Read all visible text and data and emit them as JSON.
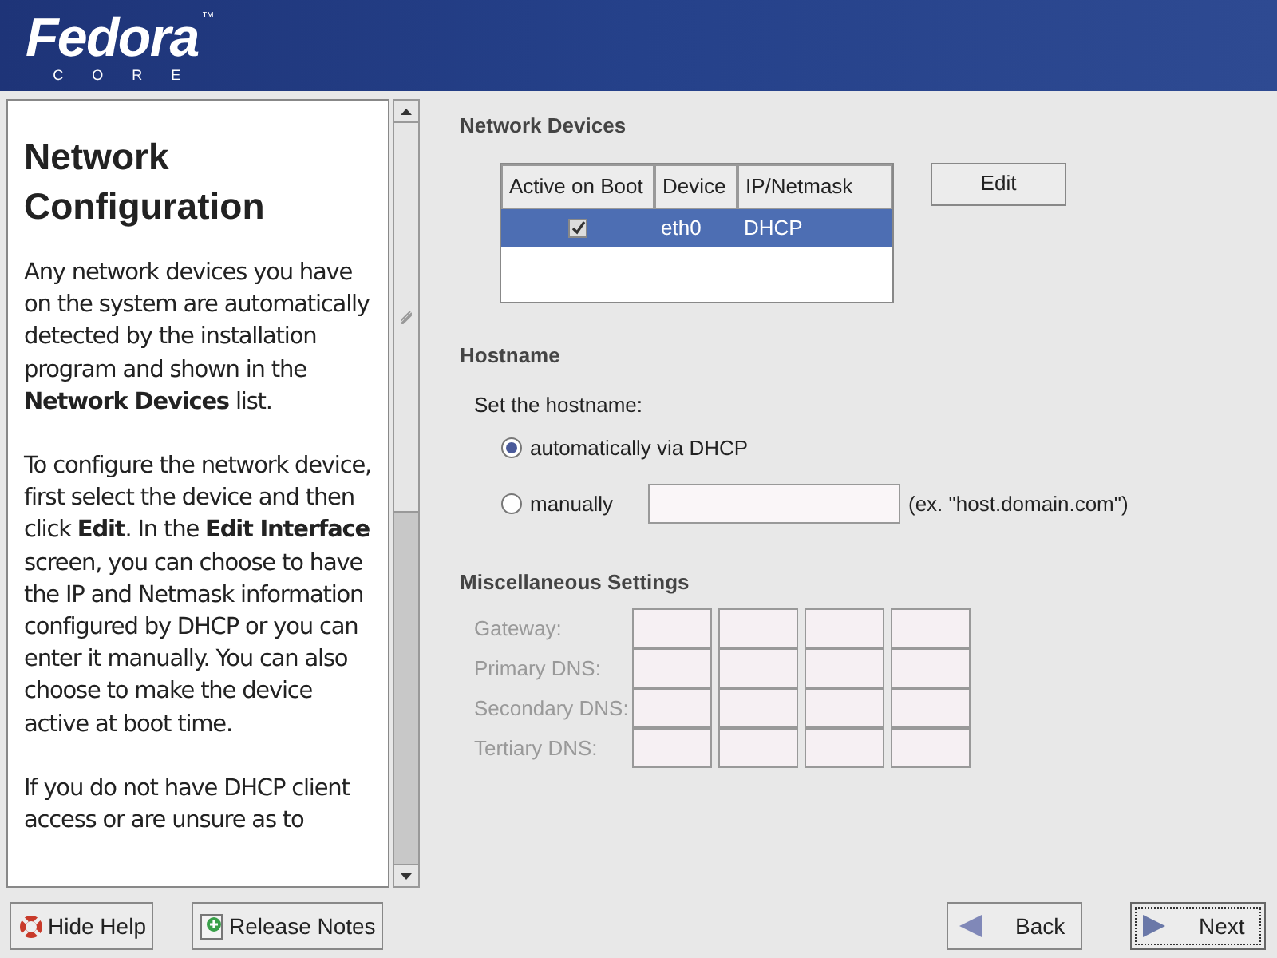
{
  "header": {
    "logo": "Fedora",
    "trademark": "™",
    "subtitle": "CORE"
  },
  "help": {
    "title": "Network Configuration",
    "paragraphs": [
      "Any network devices you have on the system are automatically detected by the installation program and shown in the **Network Devices** list.",
      "To configure the network device, first select the device and then click **Edit**. In the **Edit Interface** screen, you can choose to have the IP and Netmask information configured by DHCP or you can enter it manually. You can also choose to make the device active at boot time.",
      "If you do not have DHCP client access or are unsure as to"
    ]
  },
  "network_devices": {
    "title": "Network Devices",
    "columns": [
      "Active on Boot",
      "Device",
      "IP/Netmask"
    ],
    "rows": [
      {
        "active_on_boot": true,
        "device": "eth0",
        "ip_netmask": "DHCP",
        "selected": true
      }
    ],
    "edit_button": "Edit"
  },
  "hostname": {
    "title": "Hostname",
    "prompt": "Set the hostname:",
    "options": [
      {
        "label": "automatically via DHCP",
        "selected": true
      },
      {
        "label": "manually",
        "selected": false
      }
    ],
    "example": "(ex. \"host.domain.com\")"
  },
  "misc": {
    "title": "Miscellaneous Settings",
    "disabled": true,
    "fields": [
      {
        "label": "Gateway:"
      },
      {
        "label": "Primary DNS:"
      },
      {
        "label": "Secondary DNS:"
      },
      {
        "label": "Tertiary DNS:"
      }
    ]
  },
  "buttons": {
    "hide_help": "Hide Help",
    "release_notes": "Release Notes",
    "back": "Back",
    "next": "Next"
  }
}
